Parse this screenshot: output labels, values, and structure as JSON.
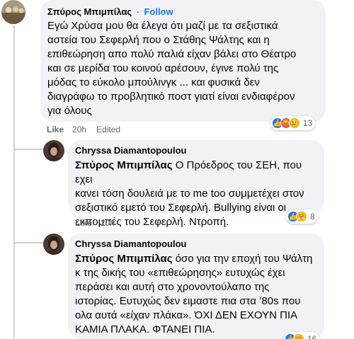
{
  "comments": [
    {
      "author": "Σπύρος Μπιμπίλας",
      "follow_label": "Follow",
      "separator": "·",
      "text": "Εγώ Χρύσα μου θα έλεγα ότι μαζί με τα σεξιστικά\nαστεία του Σεφερλή που ο Στάθης Ψάλτης και η\nεπιθεώρηση απο πολύ παλιά είχαν βάλει στο Θέατρο\nκαι σε μερίδα του κοινού αρέσουν, έγινε πολύ της\nμόδας το εύκολο μπούλινγκ ... και φυσικά δεν\nδιαγράφω το προβλητικό ποστ γιατί είναι ενδιαφέρον\nγια όλους",
      "like_label": "Like",
      "time": "20h",
      "edited_label": "Edited",
      "reaction_count": "13",
      "reactions": [
        "like-icon",
        "angry-icon",
        "sad-icon"
      ]
    },
    {
      "author": "Chryssa Diamantopoulou",
      "mention": "Σπύρος Μπιμπίλας",
      "text": " Ο Πρόεδρος του ΣΕΗ, που εχει\nκανει τόση δουλειά με το me too συμμετέχει στον\nσεξιστικό εμετό του Σεφερλή. Bullying είναι οι\nεκπομπές του Σεφερλή. Ντροπή.",
      "like_label": "Like",
      "time": "20h",
      "reaction_count": "8",
      "reactions": [
        "like-icon",
        "care-icon"
      ]
    },
    {
      "author": "Chryssa Diamantopoulou",
      "mention": "Σπύρος Μπιμπίλας",
      "text": " όσο για την εποχή του Ψάλτη\nκ της δικής του «επιθεώρησης» ευτυχώς έχει\nπεράσει και αυτή στο χρονοντούλαπο της\nιστορίας. Ευτυχώς δεν ειμαστε πια στα ’80s που\nολα αυτά «είχαν πλάκα». ΌΧΙ ΔΕΝ ΕΧΟΥΝ ΠΙΑ\nΚΑΜΙΑ ΠΛΑΚΑ. ΦΤΑΝΕΙ ΠΙΑ.",
      "reaction_count": "16",
      "reactions": [
        "like-icon",
        "care-icon"
      ]
    }
  ],
  "colors": {
    "bubble": "#f0f2f5",
    "link": "#1877f2",
    "meta": "#65676b",
    "text": "#050505"
  }
}
